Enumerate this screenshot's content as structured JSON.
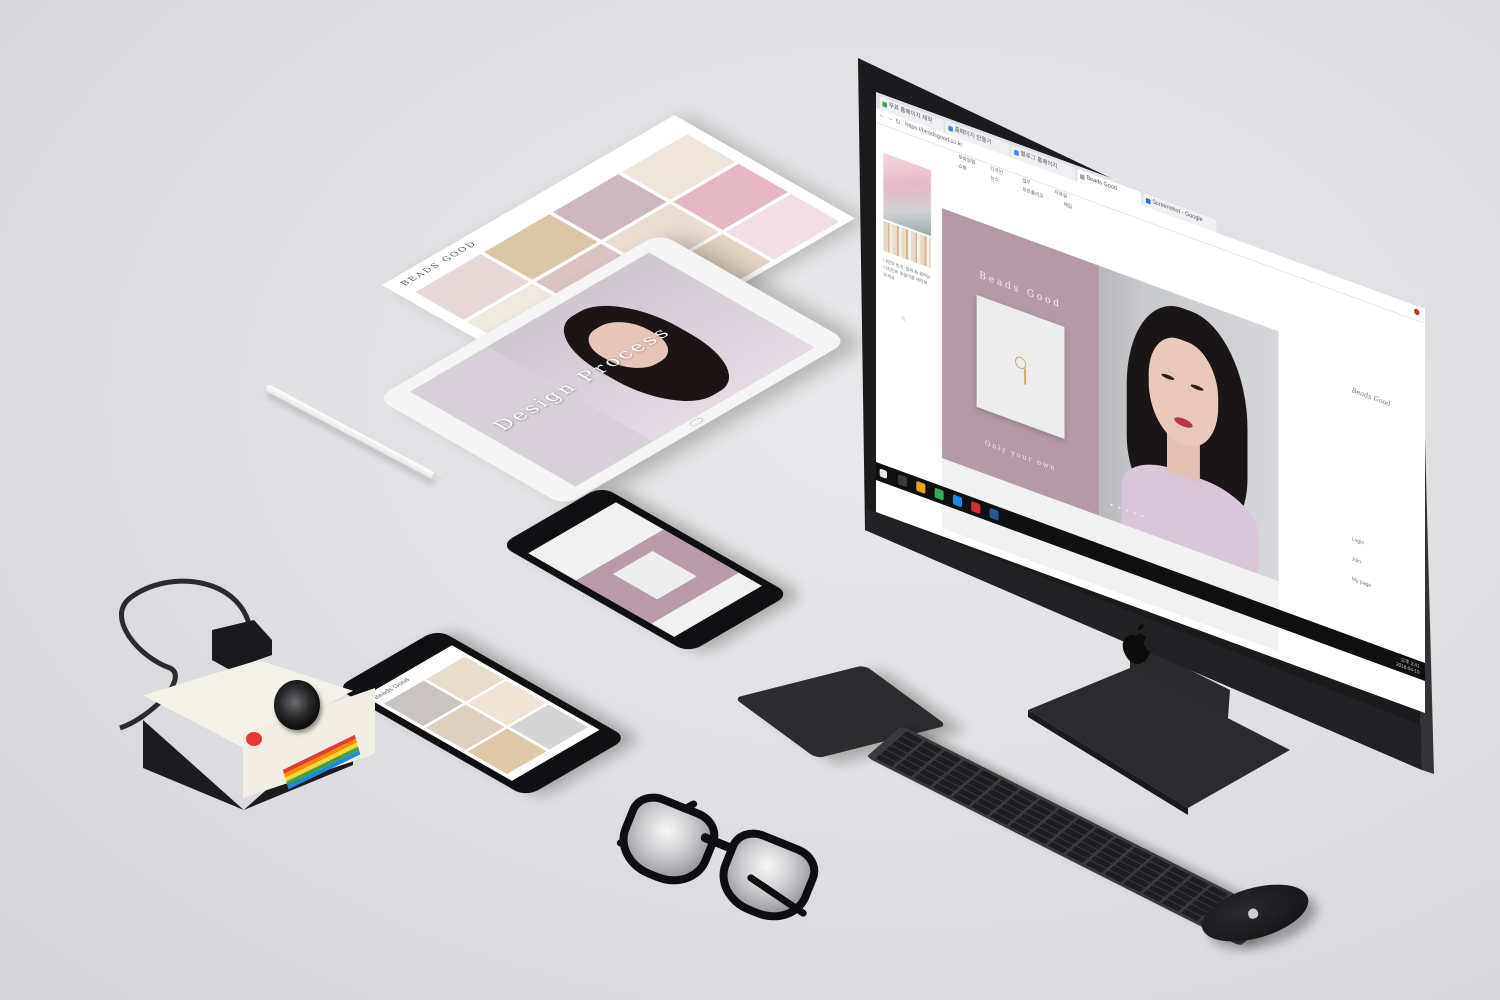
{
  "desktop": {
    "browser_tabs": [
      "무료 홈페이지 제작",
      "홈페이지 만들기",
      "블로그 홈페이지",
      "Beads Good",
      "Screenshot - Google"
    ],
    "url": "https://beadsgood.co.kr",
    "bookmarks": [
      "모바일앱",
      "디자인",
      "업무",
      "자료실",
      "쇼핑",
      "뉴스",
      "포트폴리오",
      "메일"
    ],
    "side_caption": "나만의 반지, 팔찌 등 원하는 디자인의 주얼리를 제작해 보세요",
    "hero_brand": "Beads Good",
    "hero_tagline": "Only your own",
    "right_nav": {
      "logo": "Beads Good",
      "items": [
        "Login",
        "Join",
        "My page"
      ]
    },
    "slider_dots": "● ● ● ● ●",
    "clock_time": "오후 3:41",
    "clock_date": "2018-04-19"
  },
  "tablet": {
    "overlay_brand": "BEADS GOOD",
    "hero_title": "Design Process"
  },
  "mobile": {
    "title": "Beads Good"
  },
  "colors": {
    "brand_pink": "#b49aa6",
    "background": "#e2e2e5",
    "device_dark": "#1c1c1e",
    "polaroid_red": "#e53935"
  }
}
